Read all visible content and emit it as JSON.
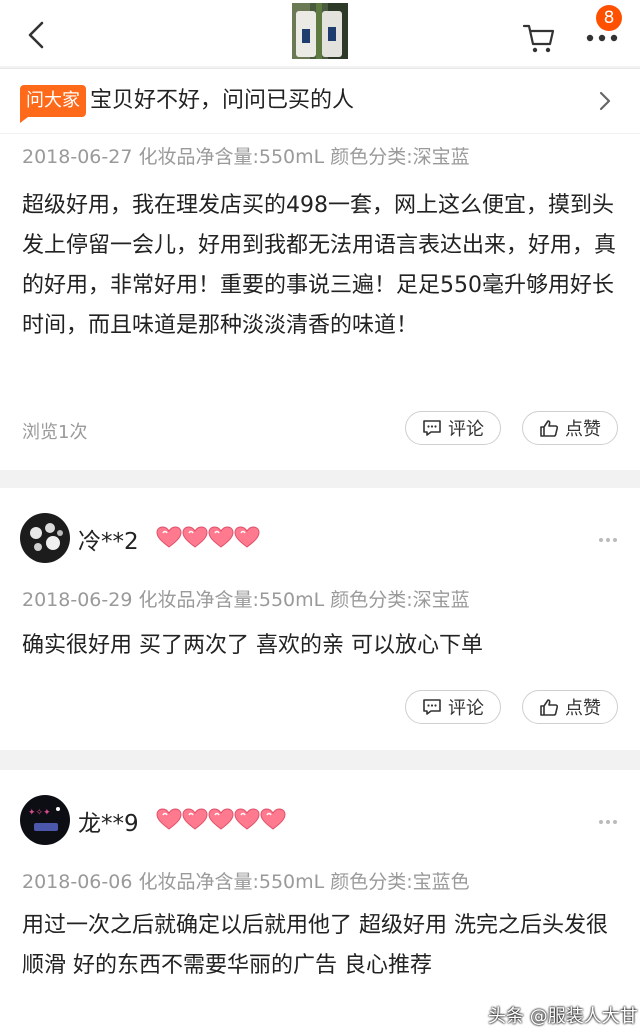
{
  "nav": {
    "badge_count": "8",
    "icons": [
      "back-arrow-icon",
      "cart-icon",
      "more-icon"
    ]
  },
  "ask": {
    "tag": "问大家",
    "text": "宝贝好不好，问问已买的人"
  },
  "reviews": [
    {
      "meta": "2018-06-27  化妆品净含量:550mL 颜色分类:深宝蓝",
      "content": "超级好用，我在理发店买的498一套，网上这么便宜，摸到头发上停留一会儿，好用到我都无法用语言表达出来，好用，真的好用，非常好用！重要的事说三遍！足足550毫升够用好长时间，而且味道是那种淡淡清香的味道！",
      "views": "浏览1次",
      "comment_label": "评论",
      "like_label": "点赞"
    },
    {
      "username": "冷**2",
      "hearts": 4,
      "meta": "2018-06-29  化妆品净含量:550mL 颜色分类:深宝蓝",
      "content": "确实很好用 买了两次了 喜欢的亲 可以放心下单",
      "comment_label": "评论",
      "like_label": "点赞"
    },
    {
      "username": "龙**9",
      "hearts": 5,
      "meta": "2018-06-06  化妆品净含量:550mL 颜色分类:宝蓝色",
      "content": "用过一次之后就确定以后就用他了  超级好用  洗完之后头发很顺滑   好的东西不需要华丽的广告 良心推荐"
    }
  ],
  "watermark": "头条 @服装人大甘",
  "colors": {
    "accent": "#ff5000",
    "heart": "#ff6f86",
    "meta_text": "#9a9a9a"
  }
}
